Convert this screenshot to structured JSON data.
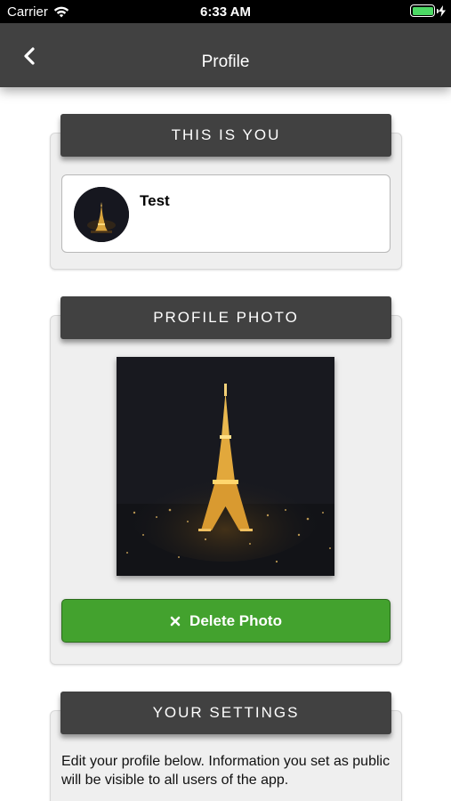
{
  "status_bar": {
    "carrier": "Carrier",
    "time": "6:33 AM"
  },
  "nav": {
    "title": "Profile",
    "back_icon": "chevron-left-icon"
  },
  "this_is_you": {
    "header": "THIS IS YOU",
    "user_name": "Test"
  },
  "profile_photo": {
    "header": "PROFILE PHOTO",
    "delete_label": "Delete Photo",
    "delete_icon": "close-icon"
  },
  "settings": {
    "header": "YOUR SETTINGS",
    "description": "Edit your profile below. Information you set as public will be visible to all users of the app."
  },
  "colors": {
    "nav_bg": "#414141",
    "accent_green": "#43a22e",
    "card_bg": "#efefef"
  }
}
